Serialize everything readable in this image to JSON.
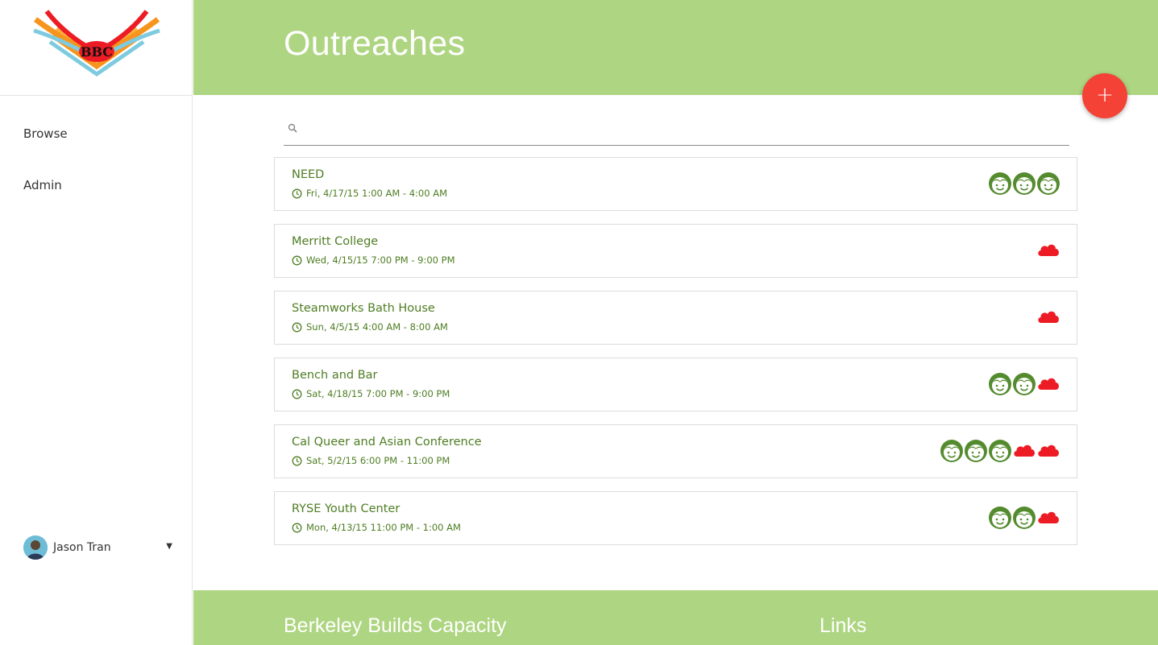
{
  "app": {
    "logo_text": "BBC"
  },
  "sidebar": {
    "items": [
      {
        "label": "Browse"
      },
      {
        "label": "Admin"
      }
    ],
    "user": {
      "name": "Jason Tran"
    }
  },
  "header": {
    "title": "Outreaches"
  },
  "fab": {
    "label": "+"
  },
  "search": {
    "placeholder": ""
  },
  "outreaches": [
    {
      "name": "NEED",
      "time": "Fri, 4/17/15 1:00 AM - 4:00 AM",
      "icons": [
        "face",
        "face",
        "face"
      ]
    },
    {
      "name": "Merritt College",
      "time": "Wed, 4/15/15 7:00 PM - 9:00 PM",
      "icons": [
        "cloud"
      ]
    },
    {
      "name": "Steamworks Bath House",
      "time": "Sun, 4/5/15 4:00 AM - 8:00 AM",
      "icons": [
        "cloud"
      ]
    },
    {
      "name": "Bench and Bar",
      "time": "Sat, 4/18/15 7:00 PM - 9:00 PM",
      "icons": [
        "face",
        "face",
        "cloud"
      ]
    },
    {
      "name": "Cal Queer and Asian Conference",
      "time": "Sat, 5/2/15 6:00 PM - 11:00 PM",
      "icons": [
        "face",
        "face",
        "face",
        "cloud",
        "cloud"
      ]
    },
    {
      "name": "RYSE Youth Center",
      "time": "Mon, 4/13/15 11:00 PM - 1:00 AM",
      "icons": [
        "face",
        "face",
        "cloud"
      ]
    }
  ],
  "footer": {
    "title": "Berkeley Builds Capacity",
    "links_title": "Links"
  },
  "colors": {
    "header_green": "#aed581",
    "text_green": "#4e7d22",
    "face_green": "#558b2f",
    "cloud_red": "#ed1c24",
    "fab_red": "#f44336"
  }
}
